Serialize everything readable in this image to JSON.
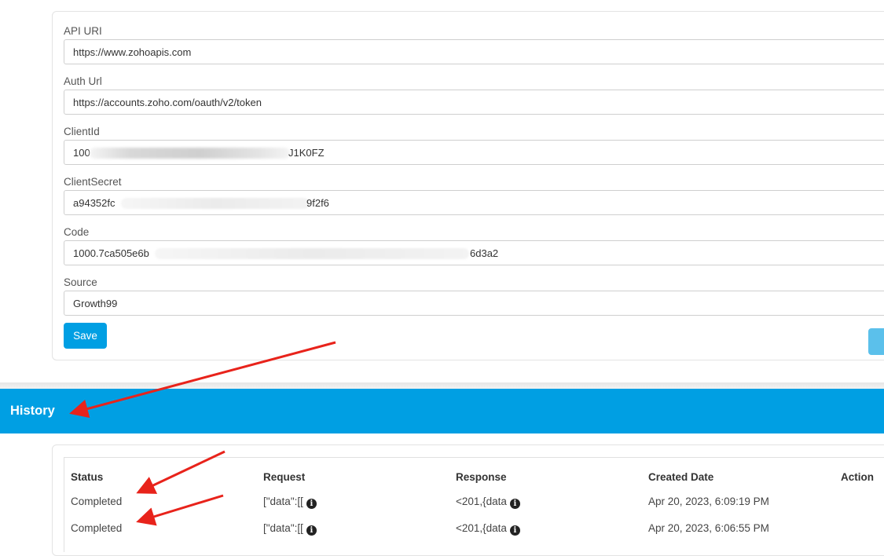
{
  "form": {
    "fields": [
      {
        "label": "API URI",
        "value": "https://www.zohoapis.com"
      },
      {
        "label": "Auth Url",
        "value": "https://accounts.zoho.com/oauth/v2/token"
      },
      {
        "label": "ClientId",
        "value_start": "100",
        "value_end": "J1K0FZ"
      },
      {
        "label": "ClientSecret",
        "value_start": "a94352fc",
        "value_end": "9f2f6"
      },
      {
        "label": "Code",
        "value_start": "1000.7ca505e6b",
        "value_end": "6d3a2"
      },
      {
        "label": "Source",
        "value": "Growth99"
      }
    ],
    "save_label": "Save"
  },
  "history": {
    "title": "History",
    "columns": [
      "Status",
      "Request",
      "Response",
      "Created Date",
      "Action"
    ],
    "rows": [
      {
        "status": "Completed",
        "request": "[\"data\":[[",
        "response": "<201,{data",
        "created": "Apr 20, 2023, 6:09:19 PM"
      },
      {
        "status": "Completed",
        "request": "[\"data\":[[",
        "response": "<201,{data",
        "created": "Apr 20, 2023, 6:06:55 PM"
      }
    ]
  },
  "colors": {
    "accent": "#009fe3",
    "annotation": "#e8231b"
  }
}
